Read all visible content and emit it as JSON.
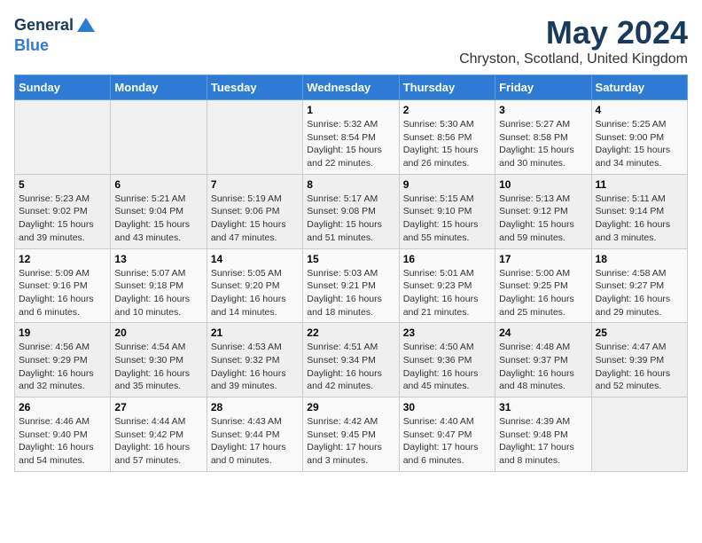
{
  "logo": {
    "general": "General",
    "blue": "Blue"
  },
  "title": "May 2024",
  "subtitle": "Chryston, Scotland, United Kingdom",
  "days_of_week": [
    "Sunday",
    "Monday",
    "Tuesday",
    "Wednesday",
    "Thursday",
    "Friday",
    "Saturday"
  ],
  "weeks": [
    [
      {
        "day": "",
        "info": ""
      },
      {
        "day": "",
        "info": ""
      },
      {
        "day": "",
        "info": ""
      },
      {
        "day": "1",
        "info": "Sunrise: 5:32 AM\nSunset: 8:54 PM\nDaylight: 15 hours\nand 22 minutes."
      },
      {
        "day": "2",
        "info": "Sunrise: 5:30 AM\nSunset: 8:56 PM\nDaylight: 15 hours\nand 26 minutes."
      },
      {
        "day": "3",
        "info": "Sunrise: 5:27 AM\nSunset: 8:58 PM\nDaylight: 15 hours\nand 30 minutes."
      },
      {
        "day": "4",
        "info": "Sunrise: 5:25 AM\nSunset: 9:00 PM\nDaylight: 15 hours\nand 34 minutes."
      }
    ],
    [
      {
        "day": "5",
        "info": "Sunrise: 5:23 AM\nSunset: 9:02 PM\nDaylight: 15 hours\nand 39 minutes."
      },
      {
        "day": "6",
        "info": "Sunrise: 5:21 AM\nSunset: 9:04 PM\nDaylight: 15 hours\nand 43 minutes."
      },
      {
        "day": "7",
        "info": "Sunrise: 5:19 AM\nSunset: 9:06 PM\nDaylight: 15 hours\nand 47 minutes."
      },
      {
        "day": "8",
        "info": "Sunrise: 5:17 AM\nSunset: 9:08 PM\nDaylight: 15 hours\nand 51 minutes."
      },
      {
        "day": "9",
        "info": "Sunrise: 5:15 AM\nSunset: 9:10 PM\nDaylight: 15 hours\nand 55 minutes."
      },
      {
        "day": "10",
        "info": "Sunrise: 5:13 AM\nSunset: 9:12 PM\nDaylight: 15 hours\nand 59 minutes."
      },
      {
        "day": "11",
        "info": "Sunrise: 5:11 AM\nSunset: 9:14 PM\nDaylight: 16 hours\nand 3 minutes."
      }
    ],
    [
      {
        "day": "12",
        "info": "Sunrise: 5:09 AM\nSunset: 9:16 PM\nDaylight: 16 hours\nand 6 minutes."
      },
      {
        "day": "13",
        "info": "Sunrise: 5:07 AM\nSunset: 9:18 PM\nDaylight: 16 hours\nand 10 minutes."
      },
      {
        "day": "14",
        "info": "Sunrise: 5:05 AM\nSunset: 9:20 PM\nDaylight: 16 hours\nand 14 minutes."
      },
      {
        "day": "15",
        "info": "Sunrise: 5:03 AM\nSunset: 9:21 PM\nDaylight: 16 hours\nand 18 minutes."
      },
      {
        "day": "16",
        "info": "Sunrise: 5:01 AM\nSunset: 9:23 PM\nDaylight: 16 hours\nand 21 minutes."
      },
      {
        "day": "17",
        "info": "Sunrise: 5:00 AM\nSunset: 9:25 PM\nDaylight: 16 hours\nand 25 minutes."
      },
      {
        "day": "18",
        "info": "Sunrise: 4:58 AM\nSunset: 9:27 PM\nDaylight: 16 hours\nand 29 minutes."
      }
    ],
    [
      {
        "day": "19",
        "info": "Sunrise: 4:56 AM\nSunset: 9:29 PM\nDaylight: 16 hours\nand 32 minutes."
      },
      {
        "day": "20",
        "info": "Sunrise: 4:54 AM\nSunset: 9:30 PM\nDaylight: 16 hours\nand 35 minutes."
      },
      {
        "day": "21",
        "info": "Sunrise: 4:53 AM\nSunset: 9:32 PM\nDaylight: 16 hours\nand 39 minutes."
      },
      {
        "day": "22",
        "info": "Sunrise: 4:51 AM\nSunset: 9:34 PM\nDaylight: 16 hours\nand 42 minutes."
      },
      {
        "day": "23",
        "info": "Sunrise: 4:50 AM\nSunset: 9:36 PM\nDaylight: 16 hours\nand 45 minutes."
      },
      {
        "day": "24",
        "info": "Sunrise: 4:48 AM\nSunset: 9:37 PM\nDaylight: 16 hours\nand 48 minutes."
      },
      {
        "day": "25",
        "info": "Sunrise: 4:47 AM\nSunset: 9:39 PM\nDaylight: 16 hours\nand 52 minutes."
      }
    ],
    [
      {
        "day": "26",
        "info": "Sunrise: 4:46 AM\nSunset: 9:40 PM\nDaylight: 16 hours\nand 54 minutes."
      },
      {
        "day": "27",
        "info": "Sunrise: 4:44 AM\nSunset: 9:42 PM\nDaylight: 16 hours\nand 57 minutes."
      },
      {
        "day": "28",
        "info": "Sunrise: 4:43 AM\nSunset: 9:44 PM\nDaylight: 17 hours\nand 0 minutes."
      },
      {
        "day": "29",
        "info": "Sunrise: 4:42 AM\nSunset: 9:45 PM\nDaylight: 17 hours\nand 3 minutes."
      },
      {
        "day": "30",
        "info": "Sunrise: 4:40 AM\nSunset: 9:47 PM\nDaylight: 17 hours\nand 6 minutes."
      },
      {
        "day": "31",
        "info": "Sunrise: 4:39 AM\nSunset: 9:48 PM\nDaylight: 17 hours\nand 8 minutes."
      },
      {
        "day": "",
        "info": ""
      }
    ]
  ]
}
